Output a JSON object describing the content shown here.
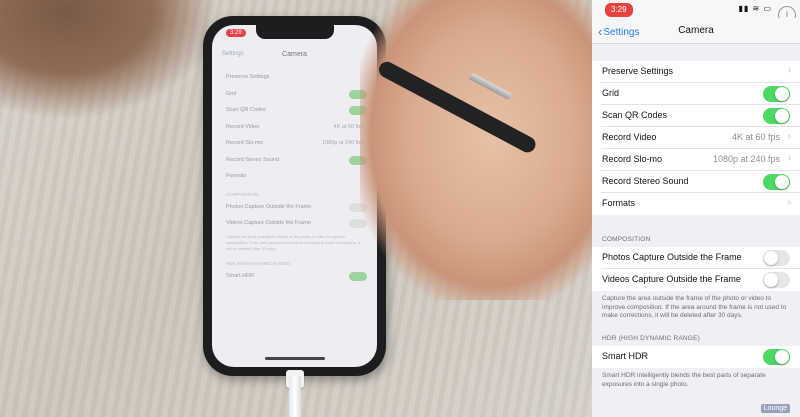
{
  "status": {
    "time": "3:29",
    "icons": "▮▮ ≋ ▭"
  },
  "nav": {
    "back_label": "Settings",
    "title": "Camera"
  },
  "group1": [
    {
      "label": "Preserve Settings",
      "type": "link"
    },
    {
      "label": "Grid",
      "type": "toggle",
      "on": true
    },
    {
      "label": "Scan QR Codes",
      "type": "toggle",
      "on": true
    },
    {
      "label": "Record Video",
      "type": "link",
      "value": "4K at 60 fps"
    },
    {
      "label": "Record Slo-mo",
      "type": "link",
      "value": "1080p at 240 fps"
    },
    {
      "label": "Record Stereo Sound",
      "type": "toggle",
      "on": true
    },
    {
      "label": "Formats",
      "type": "link"
    }
  ],
  "composition": {
    "header": "COMPOSITION",
    "rows": [
      {
        "label": "Photos Capture Outside the Frame",
        "type": "toggle",
        "on": false
      },
      {
        "label": "Videos Capture Outside the Frame",
        "type": "toggle",
        "on": false
      }
    ],
    "footer": "Capture the area outside the frame of the photo or video to improve composition. If the area around the frame is not used to make corrections, it will be deleted after 30 days."
  },
  "hdr": {
    "header": "HDR (HIGH DYNAMIC RANGE)",
    "rows": [
      {
        "label": "Smart HDR",
        "type": "toggle",
        "on": true
      }
    ],
    "footer": "Smart HDR intelligently blends the best parts of separate exposures into a single photo."
  },
  "watermark": "Lounge",
  "colors": {
    "accent": "#1f7ef5",
    "toggle_on": "#4cd964",
    "toggle_off": "#e5e5ea",
    "time_pill": "#e8403f"
  }
}
